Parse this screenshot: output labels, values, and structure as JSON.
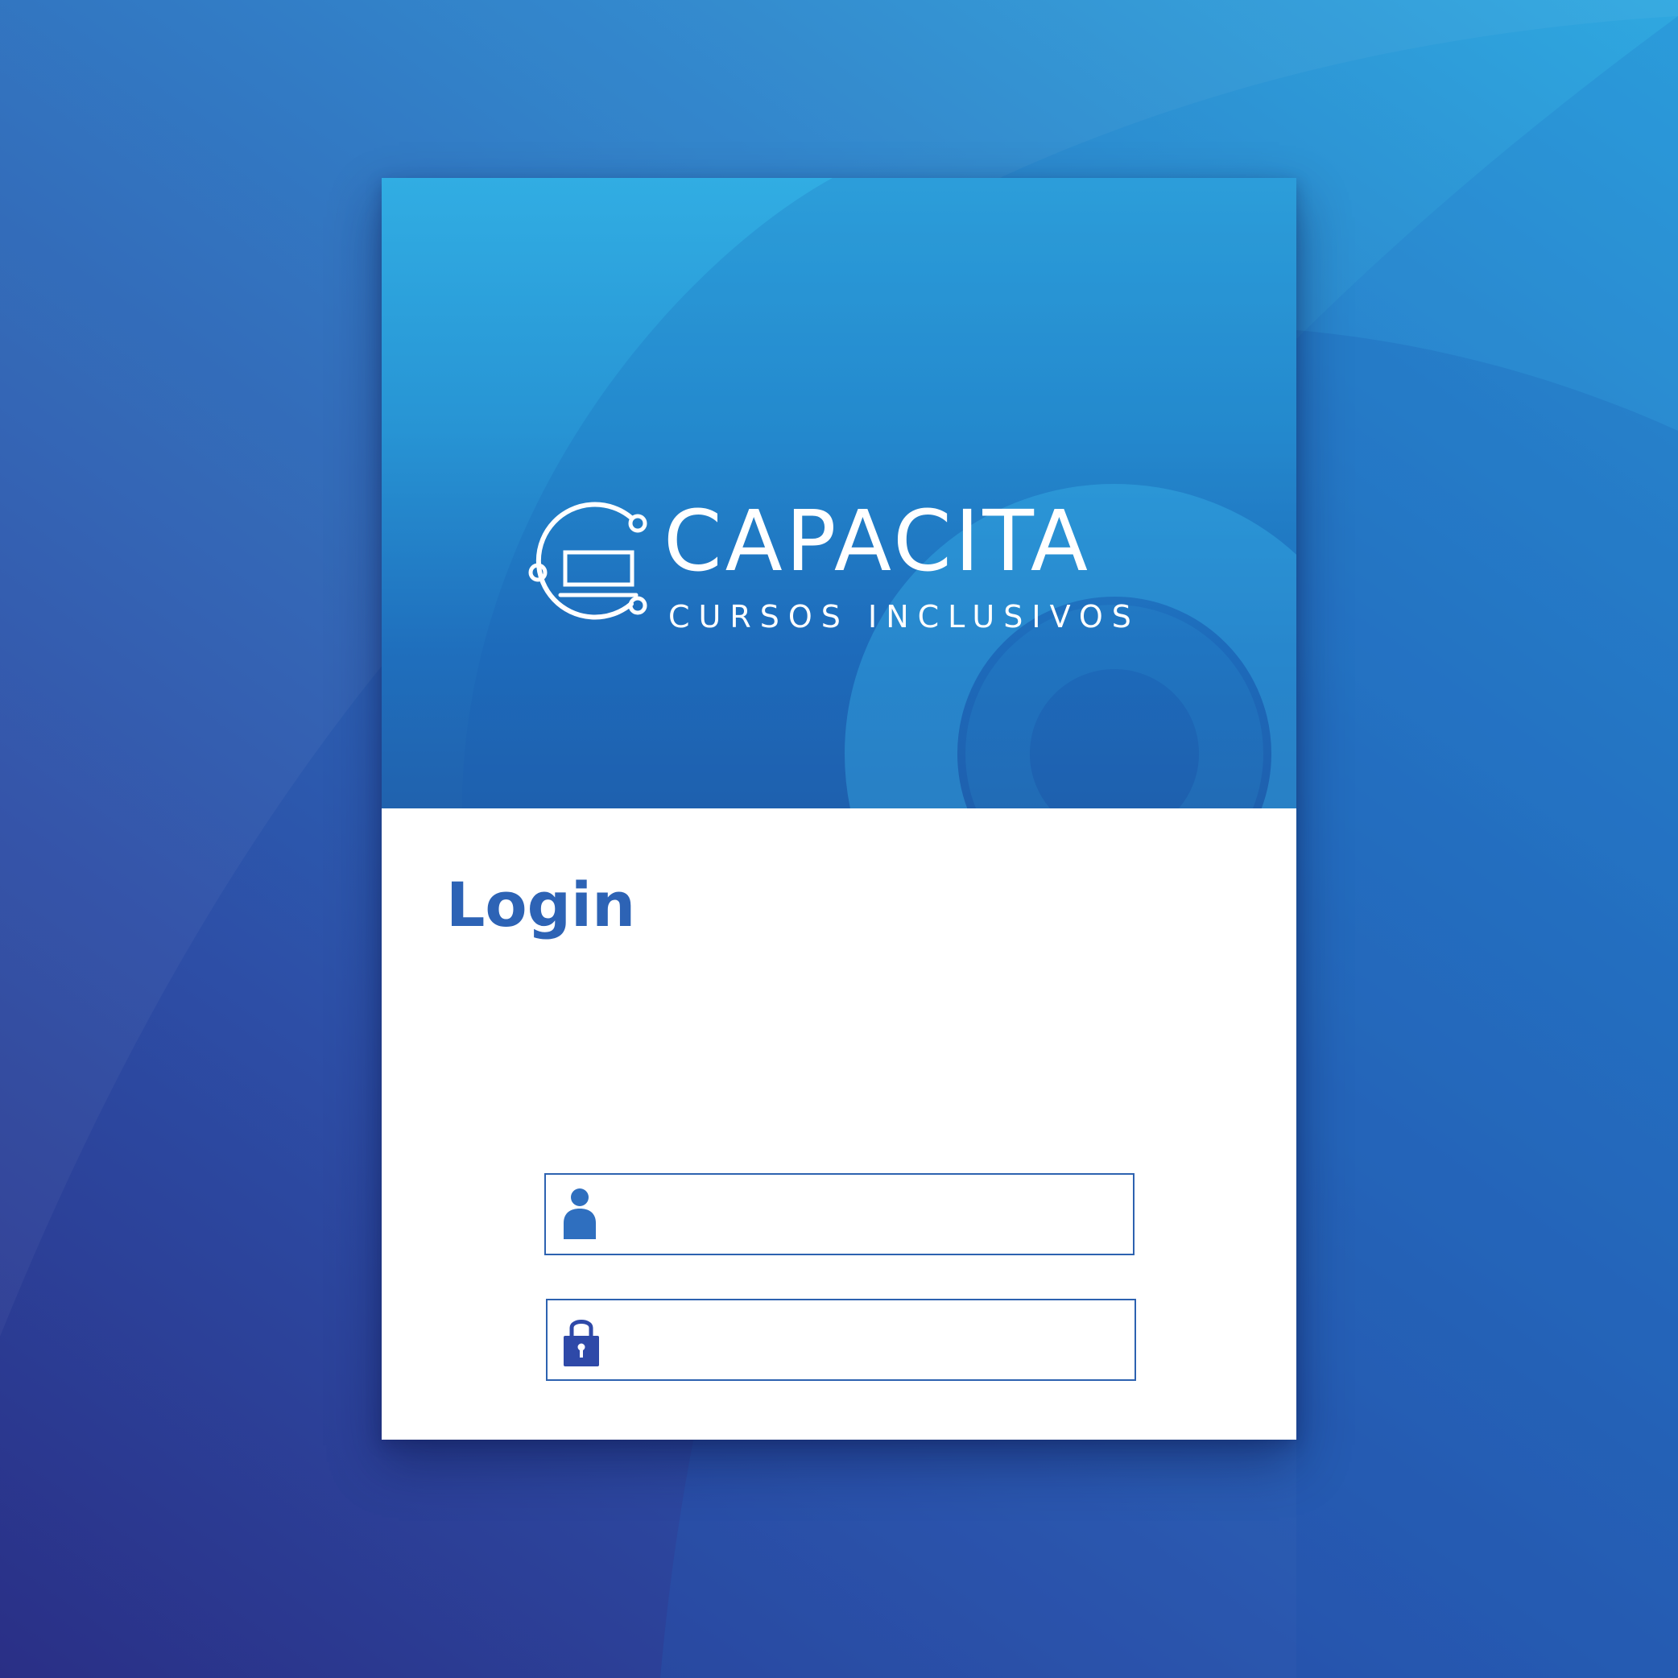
{
  "brand": {
    "name": "CAPACITA",
    "tagline": "CURSOS INCLUSIVOS",
    "logo_icon": "laptop-circuit-icon"
  },
  "login": {
    "title": "Login",
    "username": {
      "icon": "user-icon",
      "value": "",
      "placeholder": ""
    },
    "password": {
      "icon": "lock-icon",
      "value": "",
      "placeholder": ""
    }
  },
  "colors": {
    "accent": "#2d63b5",
    "field_border": "#2d62b0",
    "header_top": "#31ade3",
    "header_bottom": "#2062ae",
    "background_dark": "#2a2f86",
    "background_light": "#2fa8e0"
  }
}
